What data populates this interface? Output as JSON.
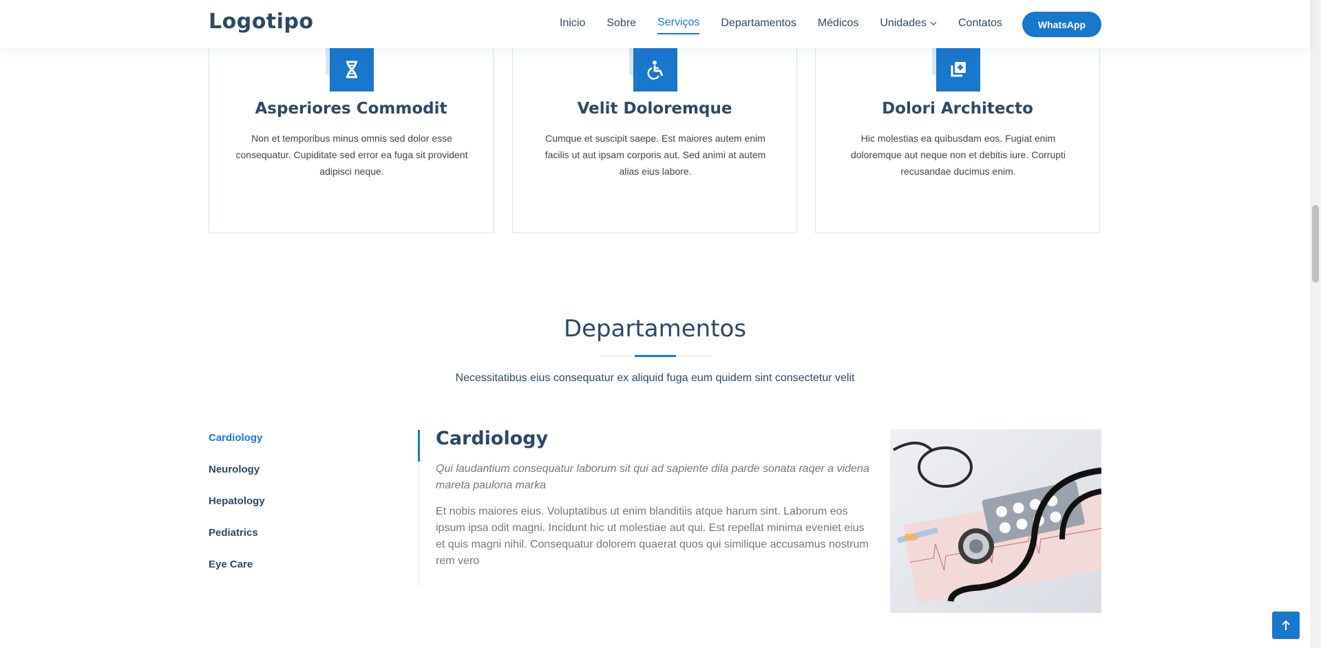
{
  "header": {
    "logo": "Logotipo",
    "nav": [
      {
        "label": "Inicio"
      },
      {
        "label": "Sobre"
      },
      {
        "label": "Serviços"
      },
      {
        "label": "Departamentos"
      },
      {
        "label": "Médicos"
      },
      {
        "label": "Unidades"
      },
      {
        "label": "Contatos"
      }
    ],
    "active_nav": "Serviços",
    "cta": "WhatsApp"
  },
  "services": [
    {
      "icon": "dna-icon",
      "title": "Asperiores Commodit",
      "text": "Non et temporibus minus omnis sed dolor esse consequatur. Cupiditate sed error ea fuga sit provident adipisci neque."
    },
    {
      "icon": "wheelchair-icon",
      "title": "Velit Doloremque",
      "text": "Cumque et suscipit saepe. Est maiores autem enim facilis ut aut ipsam corporis aut. Sed animi at autem alias eius labore."
    },
    {
      "icon": "notes-medical-icon",
      "title": "Dolori Architecto",
      "text": "Hic molestias ea quibusdam eos. Fugiat enim doloremque aut neque non et debitis iure. Corrupti recusandae ducimus enim."
    }
  ],
  "departments": {
    "title": "Departamentos",
    "subtitle": "Necessitatibus eius consequatur ex aliquid fuga eum quidem sint consectetur velit",
    "tabs": [
      "Cardiology",
      "Neurology",
      "Hepatology",
      "Pediatrics",
      "Eye Care"
    ],
    "active_tab": "Cardiology",
    "detail": {
      "title": "Cardiology",
      "lead": "Qui laudantium consequatur laborum sit qui ad sapiente dila parde sonata raqer a videna mareta paulona marka",
      "body": "Et nobis maiores eius. Voluptatibus ut enim blanditiis atque harum sint. Laborum eos ipsum ipsa odit magni. Incidunt hic ut molestiae aut qui. Est repellat minima eveniet eius et quis magni nihil. Consequatur dolorem quaerat quos qui similique accusamus nostrum rem vero"
    }
  },
  "colors": {
    "accent": "#1977cc",
    "heading": "#2c4964",
    "text": "#444444",
    "muted": "#777777"
  }
}
